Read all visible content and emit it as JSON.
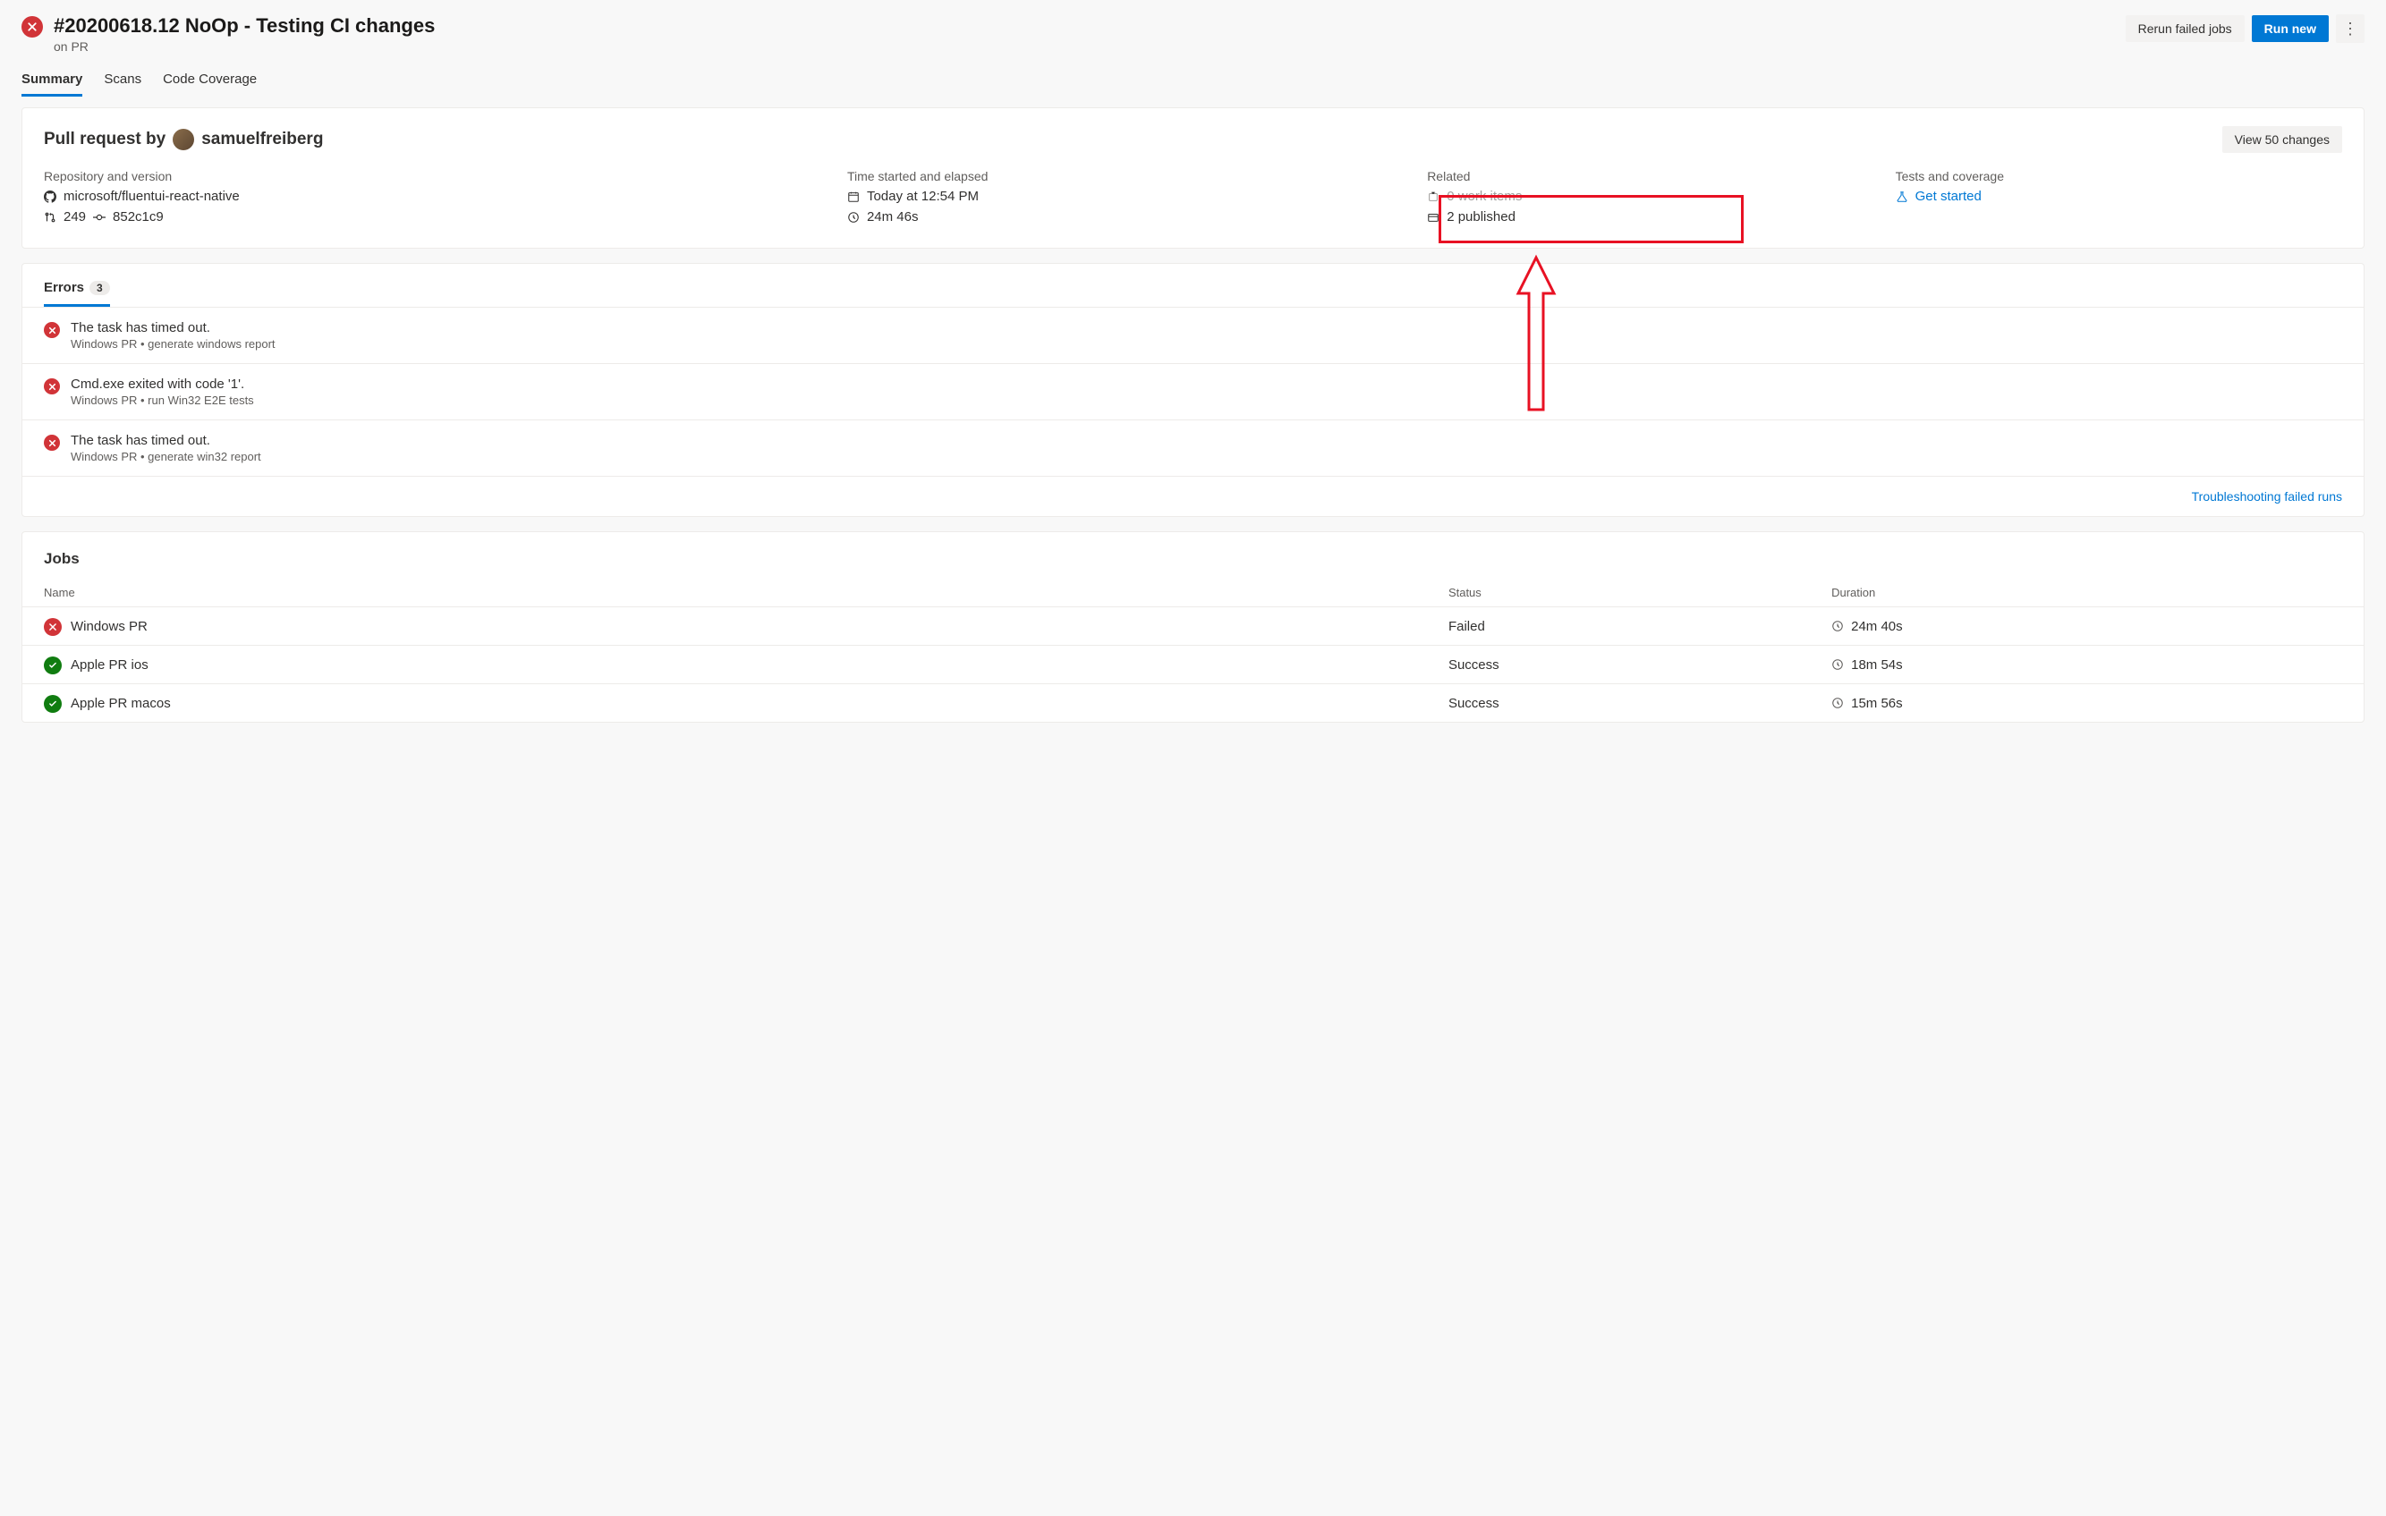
{
  "header": {
    "title": "#20200618.12 NoOp - Testing CI changes",
    "subtitle": "on PR",
    "actions": {
      "rerun": "Rerun failed jobs",
      "runNew": "Run new"
    }
  },
  "tabs": {
    "summary": "Summary",
    "scans": "Scans",
    "codeCoverage": "Code Coverage"
  },
  "pr": {
    "titlePrefix": "Pull request by",
    "author": "samuelfreiberg",
    "viewChanges": "View 50 changes",
    "cols": {
      "repo": {
        "label": "Repository and version",
        "repoName": "microsoft/fluentui-react-native",
        "prNum": "249",
        "commit": "852c1c9"
      },
      "time": {
        "label": "Time started and elapsed",
        "started": "Today at 12:54 PM",
        "elapsed": "24m 46s"
      },
      "related": {
        "label": "Related",
        "workItems": "0 work items",
        "published": "2 published"
      },
      "tests": {
        "label": "Tests and coverage",
        "getStarted": "Get started"
      }
    }
  },
  "errors": {
    "tabLabel": "Errors",
    "count": "3",
    "items": [
      {
        "msg": "The task has timed out.",
        "path": "Windows PR • generate windows report"
      },
      {
        "msg": "Cmd.exe exited with code '1'.",
        "path": "Windows PR • run Win32 E2E tests"
      },
      {
        "msg": "The task has timed out.",
        "path": "Windows PR • generate win32 report"
      }
    ],
    "troubleshoot": "Troubleshooting failed runs"
  },
  "jobs": {
    "heading": "Jobs",
    "colName": "Name",
    "colStatus": "Status",
    "colDuration": "Duration",
    "rows": [
      {
        "name": "Windows PR",
        "status": "Failed",
        "duration": "24m 40s",
        "ok": false
      },
      {
        "name": "Apple PR ios",
        "status": "Success",
        "duration": "18m 54s",
        "ok": true
      },
      {
        "name": "Apple PR macos",
        "status": "Success",
        "duration": "15m 56s",
        "ok": true
      }
    ]
  }
}
